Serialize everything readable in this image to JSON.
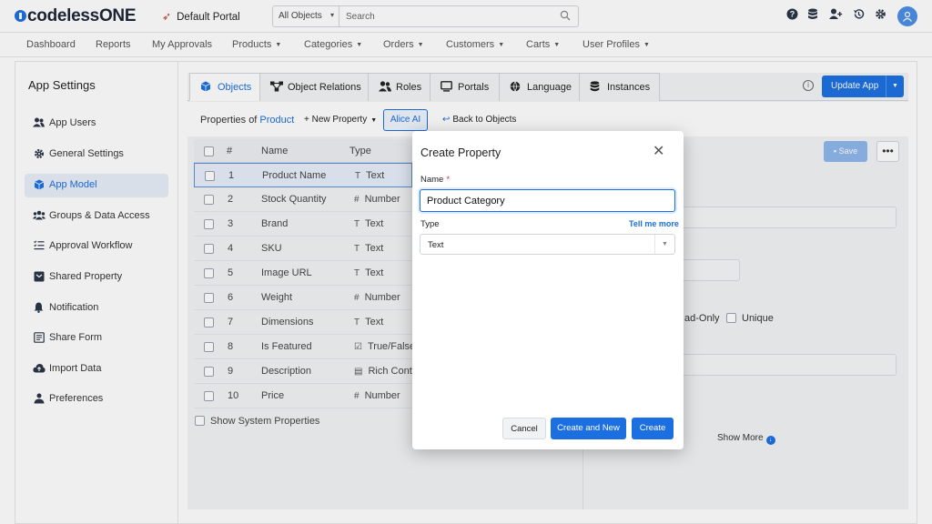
{
  "app": {
    "logo_prefix": "codeless",
    "logo_suffix": "ONE",
    "portal_name": "Default Portal"
  },
  "search": {
    "scope": "All Objects",
    "placeholder": "Search"
  },
  "top_icons": [
    "help-icon",
    "database-icon",
    "add-user-icon",
    "history-icon",
    "gear-icon",
    "user-avatar-icon"
  ],
  "nav": {
    "items": [
      {
        "label": "Dashboard",
        "dropdown": false
      },
      {
        "label": "Reports",
        "dropdown": false
      },
      {
        "label": "My Approvals",
        "dropdown": false
      },
      {
        "label": "Products",
        "dropdown": true
      },
      {
        "label": "Categories",
        "dropdown": true
      },
      {
        "label": "Orders",
        "dropdown": true
      },
      {
        "label": "Customers",
        "dropdown": true
      },
      {
        "label": "Carts",
        "dropdown": true
      },
      {
        "label": "User Profiles",
        "dropdown": true
      }
    ]
  },
  "sidebar": {
    "title": "App Settings",
    "items": [
      {
        "label": "App Users",
        "icon": "users-icon",
        "active": false
      },
      {
        "label": "General Settings",
        "icon": "gear-icon",
        "active": false
      },
      {
        "label": "App Model",
        "icon": "cube-icon",
        "active": true
      },
      {
        "label": "Groups & Data Access",
        "icon": "group-icon",
        "active": false
      },
      {
        "label": "Approval Workflow",
        "icon": "checklist-icon",
        "active": false
      },
      {
        "label": "Shared Property",
        "icon": "shared-icon",
        "active": false
      },
      {
        "label": "Notification",
        "icon": "bell-icon",
        "active": false
      },
      {
        "label": "Share Form",
        "icon": "form-icon",
        "active": false
      },
      {
        "label": "Import Data",
        "icon": "cloud-upload-icon",
        "active": false
      },
      {
        "label": "Preferences",
        "icon": "preferences-icon",
        "active": false
      }
    ]
  },
  "tabs": [
    {
      "label": "Objects",
      "icon": "cube-icon",
      "active": true
    },
    {
      "label": "Object Relations",
      "icon": "relations-icon",
      "active": false
    },
    {
      "label": "Roles",
      "icon": "roles-icon",
      "active": false
    },
    {
      "label": "Portals",
      "icon": "monitor-icon",
      "active": false
    },
    {
      "label": "Language",
      "icon": "globe-icon",
      "active": false
    },
    {
      "label": "Instances",
      "icon": "database-icon",
      "active": false
    }
  ],
  "update_button": "Update App",
  "toolbar": {
    "properties_of": "Properties of",
    "object_name": "Product",
    "new_property": "New Property",
    "alice_ai": "Alice AI",
    "back_to_objects": "Back to Objects"
  },
  "table": {
    "headers": {
      "num": "#",
      "name": "Name",
      "type": "Type"
    },
    "rows": [
      {
        "num": "1",
        "name": "Product Name",
        "type": "Text",
        "type_icon": "T",
        "selected": true
      },
      {
        "num": "2",
        "name": "Stock Quantity",
        "type": "Number",
        "type_icon": "#",
        "selected": false
      },
      {
        "num": "3",
        "name": "Brand",
        "type": "Text",
        "type_icon": "T",
        "selected": false
      },
      {
        "num": "4",
        "name": "SKU",
        "type": "Text",
        "type_icon": "T",
        "selected": false
      },
      {
        "num": "5",
        "name": "Image URL",
        "type": "Text",
        "type_icon": "T",
        "selected": false
      },
      {
        "num": "6",
        "name": "Weight",
        "type": "Number",
        "type_icon": "#",
        "selected": false
      },
      {
        "num": "7",
        "name": "Dimensions",
        "type": "Text",
        "type_icon": "T",
        "selected": false
      },
      {
        "num": "8",
        "name": "Is Featured",
        "type": "True/False",
        "type_icon": "☑",
        "selected": false
      },
      {
        "num": "9",
        "name": "Description",
        "type": "Rich Conte",
        "type_icon": "▤",
        "selected": false
      },
      {
        "num": "10",
        "name": "Price",
        "type": "Number",
        "type_icon": "#",
        "selected": false
      }
    ],
    "show_system": "Show System Properties"
  },
  "right_panel": {
    "save": "Save",
    "more": "•••",
    "read_only": "ad-Only",
    "unique": "Unique",
    "show_more": "Show More"
  },
  "modal": {
    "title": "Create Property",
    "name_label": "Name",
    "required_mark": "*",
    "name_value": "Product Category",
    "type_label": "Type",
    "tell_me_more": "Tell me more",
    "type_value": "Text",
    "cancel": "Cancel",
    "create_and_new": "Create and New",
    "create": "Create"
  },
  "colors": {
    "accent": "#1b6fe0",
    "active_bg": "#e8eef9",
    "panel_bg": "#f3f4f6"
  }
}
